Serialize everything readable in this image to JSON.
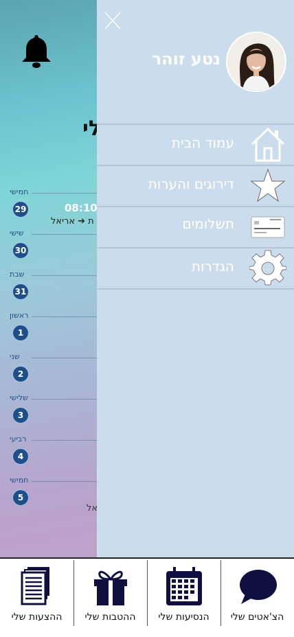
{
  "drawer": {
    "user_name": "נטע זוהר",
    "menu": [
      {
        "label": "עמוד הבית",
        "icon": "home-icon"
      },
      {
        "label": "דירוגים והערות",
        "icon": "star-icon"
      },
      {
        "label": "תשלומים",
        "icon": "credit-card-icon"
      },
      {
        "label": "הגדרות",
        "icon": "gear-icon"
      }
    ]
  },
  "background": {
    "title_partial": "לי",
    "days": [
      {
        "label": "חמישי",
        "num": "29"
      },
      {
        "label": "שישי",
        "num": "30"
      },
      {
        "label": "שבת",
        "num": "31"
      },
      {
        "label": "ראשון",
        "num": "1"
      },
      {
        "label": "שני",
        "num": "2"
      },
      {
        "label": "שלישי",
        "num": "3"
      },
      {
        "label": "רביעי",
        "num": "4"
      },
      {
        "label": "חמישי",
        "num": "5"
      }
    ],
    "trip_time": "08:10",
    "trip_route": "ת ➔ אריאל",
    "trip_route_2": "אל"
  },
  "tabs": [
    {
      "label": "ההצעות שלי",
      "icon": "documents-icon"
    },
    {
      "label": "ההטבות שלי",
      "icon": "gift-icon"
    },
    {
      "label": "הנסיעות שלי",
      "icon": "calendar-icon"
    },
    {
      "label": "הצ'אטים שלי",
      "icon": "chat-bubble-icon"
    }
  ],
  "colors": {
    "accent": "#1f4f8a",
    "drawer": "#cbdcec",
    "tab_icon": "#0f1040"
  }
}
